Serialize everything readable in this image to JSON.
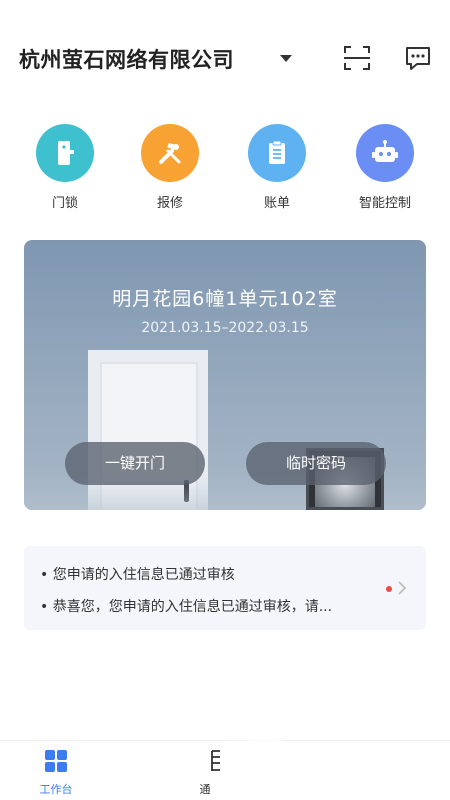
{
  "header": {
    "company_name": "杭州萤石网络有限公司",
    "dropdown_icon": "caret-down-icon",
    "scan_icon": "scan-icon",
    "message_icon": "chat-icon"
  },
  "shortcuts": [
    {
      "label": "门锁",
      "icon": "door-lock-icon",
      "color": "#3fc0cf"
    },
    {
      "label": "报修",
      "icon": "repair-tools-icon",
      "color": "#f7a232"
    },
    {
      "label": "账单",
      "icon": "bill-icon",
      "color": "#5fb2f2"
    },
    {
      "label": "智能控制",
      "icon": "robot-icon",
      "color": "#6b8ef5"
    }
  ],
  "room_card": {
    "title": "明月花园6幢1单元102室",
    "dates": "2021.03.15–2022.03.15",
    "unlock_label": "一键开门",
    "temp_password_label": "临时密码"
  },
  "notices": [
    "• 您申请的入住信息已通过审核",
    "• 恭喜您，您申请的入住信息已通过审核，请..."
  ],
  "tabbar": {
    "work_label": "工作台",
    "msg_label": "通"
  },
  "colors": {
    "accent": "#3b7cf0",
    "unread_dot": "#e94b4b"
  }
}
